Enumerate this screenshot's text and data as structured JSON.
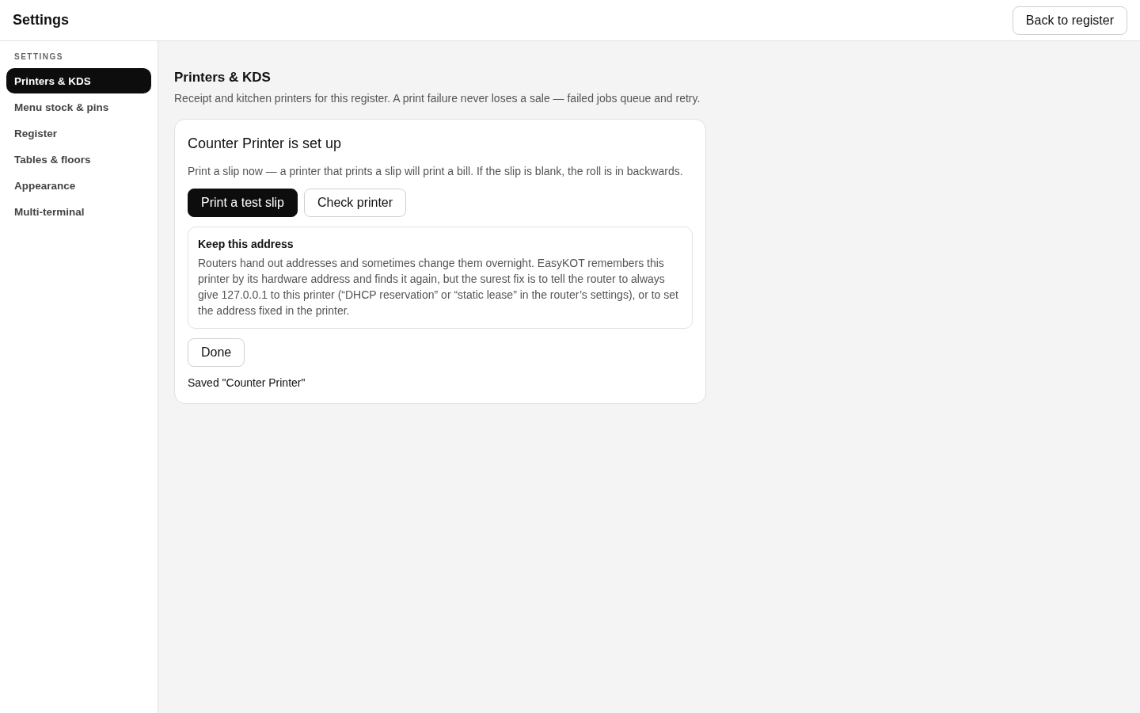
{
  "header": {
    "title": "Settings",
    "back_button": "Back to register"
  },
  "sidebar": {
    "section_label": "SETTINGS",
    "items": [
      {
        "label": "Printers & KDS",
        "selected": true
      },
      {
        "label": "Menu stock & pins",
        "selected": false
      },
      {
        "label": "Register",
        "selected": false
      },
      {
        "label": "Tables & floors",
        "selected": false
      },
      {
        "label": "Appearance",
        "selected": false
      },
      {
        "label": "Multi-terminal",
        "selected": false
      }
    ]
  },
  "page": {
    "title": "Printers & KDS",
    "description": "Receipt and kitchen printers for this register. A print failure never loses a sale — failed jobs queue and retry."
  },
  "card": {
    "title": "Counter Printer is set up",
    "text": "Print a slip now — a printer that prints a slip will print a bill. If the slip is blank, the roll is in backwards.",
    "actions": [
      {
        "label": "Print a test slip",
        "kind": "primary"
      },
      {
        "label": "Check printer",
        "kind": "secondary"
      }
    ],
    "notice": {
      "title": "Keep this address",
      "text": "Routers hand out addresses and sometimes change them overnight. EasyKOT remembers this printer by its hardware address and finds it again, but the surest fix is to tell the router to always give 127.0.0.1 to this printer (“DHCP reservation” or “static lease” in the router’s settings), or to set the address fixed in the printer."
    },
    "done_button": "Done",
    "status": "Saved \"Counter Printer\""
  }
}
